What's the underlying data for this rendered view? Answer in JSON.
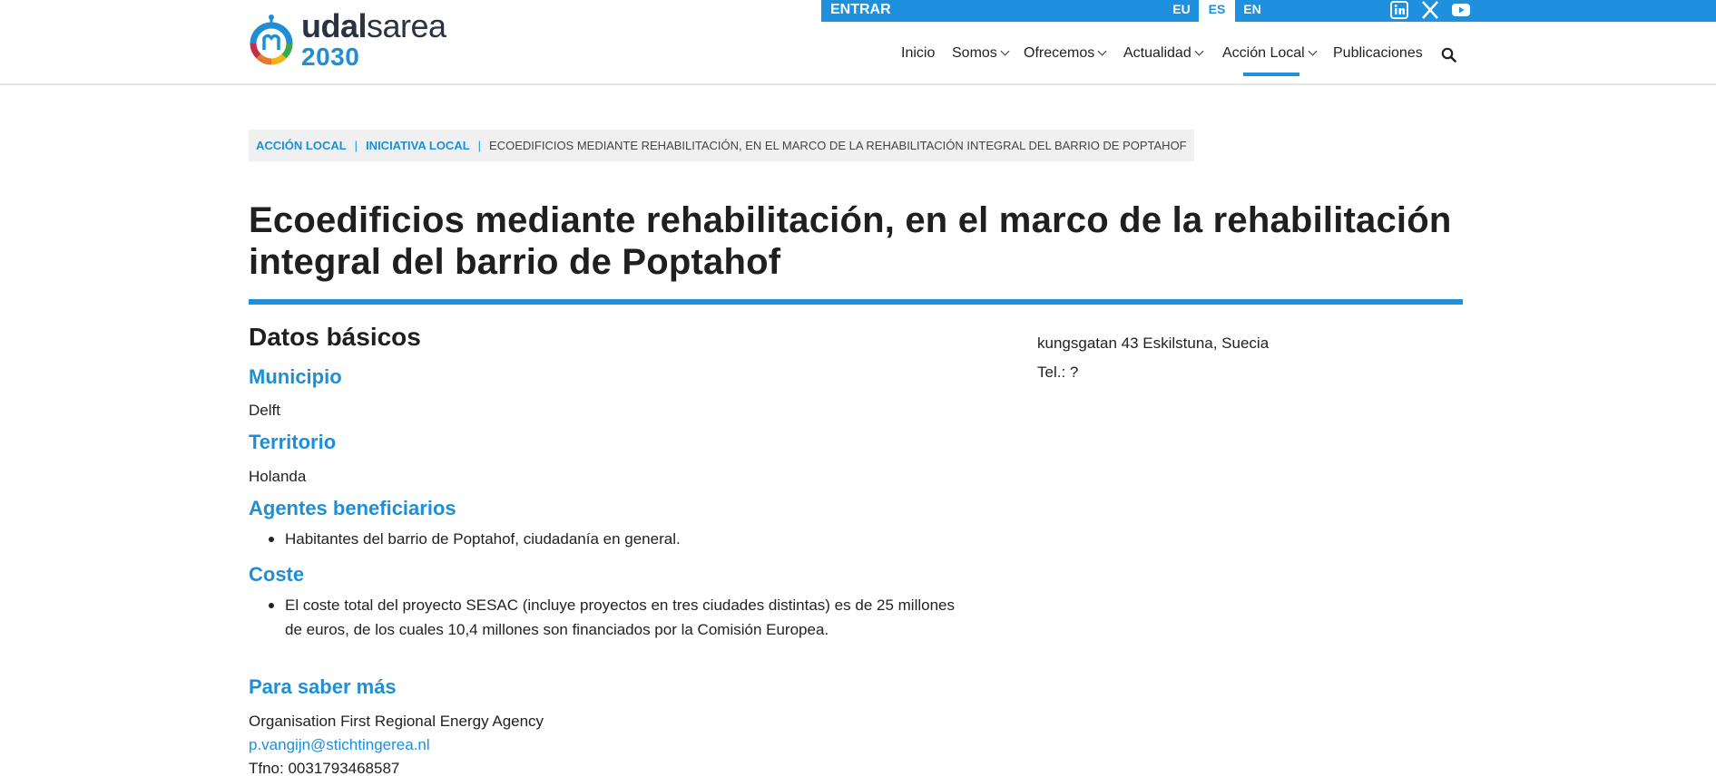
{
  "brand": {
    "name_bold": "udal",
    "name_regular": "sarea",
    "year": "2030",
    "accent_color": "#1e90dd"
  },
  "topbar": {
    "login_label": "ENTRAR",
    "languages": [
      "EU",
      "ES",
      "EN"
    ],
    "active_language": "ES",
    "social": [
      "linkedin-icon",
      "x-icon",
      "youtube-icon"
    ]
  },
  "nav": {
    "items": [
      {
        "label": "Inicio",
        "dropdown": false
      },
      {
        "label": "Somos",
        "dropdown": true
      },
      {
        "label": "Ofrecemos",
        "dropdown": true
      },
      {
        "label": "Actualidad",
        "dropdown": true
      },
      {
        "label": "Acción Local",
        "dropdown": true,
        "active": true
      },
      {
        "label": "Publicaciones",
        "dropdown": false
      }
    ],
    "search_icon": "search-icon"
  },
  "breadcrumb": {
    "items": [
      "ACCIÓN LOCAL",
      "INICIATIVA LOCAL"
    ],
    "current": "ECOEDIFICIOS MEDIANTE REHABILITACIÓN, EN EL MARCO DE LA REHABILITACIÓN INTEGRAL DEL BARRIO DE POPTAHOF"
  },
  "page": {
    "title": "Ecoedificios mediante rehabilitación, en el marco de la rehabilitación integral del barrio de Poptahof"
  },
  "basic_data": {
    "heading": "Datos básicos",
    "municipio_label": "Municipio",
    "municipio_value": "Delft",
    "territorio_label": "Territorio",
    "territorio_value": "Holanda",
    "agentes_label": "Agentes beneficiarios",
    "agentes_items": [
      "Habitantes del barrio de Poptahof, ciudadanía en general."
    ],
    "coste_label": "Coste",
    "coste_items": [
      "El coste total del proyecto SESAC (incluye proyectos en tres ciudades distintas) es de 25 millones",
      "de euros, de los cuales 10,4 millones son financiados por la Comisión Europea."
    ]
  },
  "more_info": {
    "heading": "Para saber más",
    "organisation": "Organisation First Regional Energy Agency",
    "email": "p.vangijn@stichtingerea.nl",
    "phone": "Tfno: 0031793468587"
  },
  "right_column": {
    "address": "kungsgatan 43 Eskilstuna, Suecia",
    "tel": "Tel.: ?"
  }
}
